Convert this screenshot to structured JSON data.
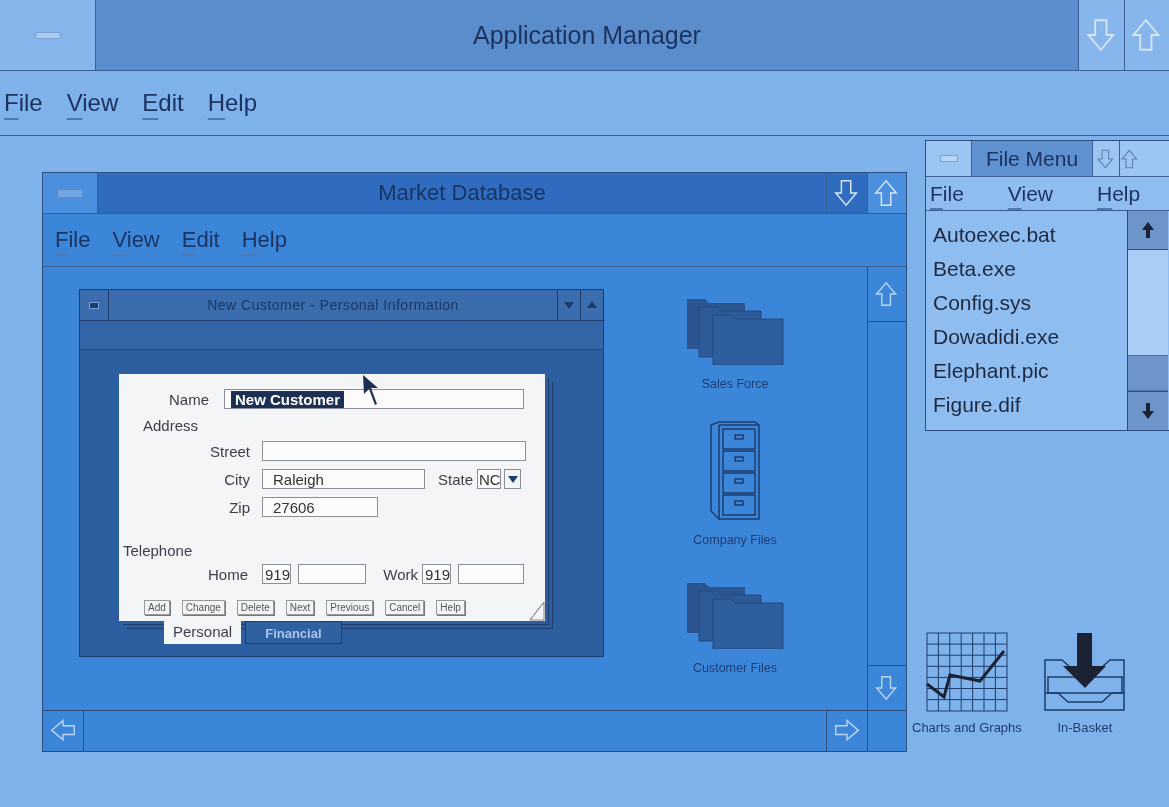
{
  "window": {
    "title": "Application Manager"
  },
  "menu": [
    "File",
    "View",
    "Edit",
    "Help"
  ],
  "market_window": {
    "title": "Market Database",
    "menu": [
      "File",
      "View",
      "Edit",
      "Help"
    ],
    "dialog": {
      "title": "New Customer - Personal Information",
      "form": {
        "name_label": "Name",
        "name_value": "New Customer",
        "name_value_selected": true,
        "address_label": "Address",
        "street_label": "Street",
        "city_label": "City",
        "city_value": "Raleigh",
        "state_label": "State",
        "state_value": "NC",
        "zip_label": "Zip",
        "zip_value": "27606",
        "telephone_label": "Telephone",
        "home_label": "Home",
        "home_area": "919",
        "work_label": "Work",
        "work_area": "919"
      },
      "buttons": [
        "Add",
        "Change",
        "Delete",
        "Next",
        "Previous",
        "Cancel",
        "Help"
      ],
      "tabs": [
        {
          "label": "Personal",
          "selected": true
        },
        {
          "label": "Financial",
          "selected": false
        }
      ]
    },
    "icons": [
      {
        "label": "Sales Force",
        "kind": "folders"
      },
      {
        "label": "Company Files",
        "kind": "cabinet"
      },
      {
        "label": "Customer Files",
        "kind": "folders"
      }
    ]
  },
  "file_menu_window": {
    "title": "File Menu",
    "menu": [
      "File",
      "View",
      "Help"
    ],
    "files": [
      "Autoexec.bat",
      "Beta.exe",
      "Config.sys",
      "Dowadidi.exe",
      "Elephant.pic",
      "Figure.dif"
    ]
  },
  "desktop_icons": [
    {
      "label": "Charts and Graphs",
      "kind": "chart"
    },
    {
      "label": "In-Basket",
      "kind": "basket"
    }
  ]
}
